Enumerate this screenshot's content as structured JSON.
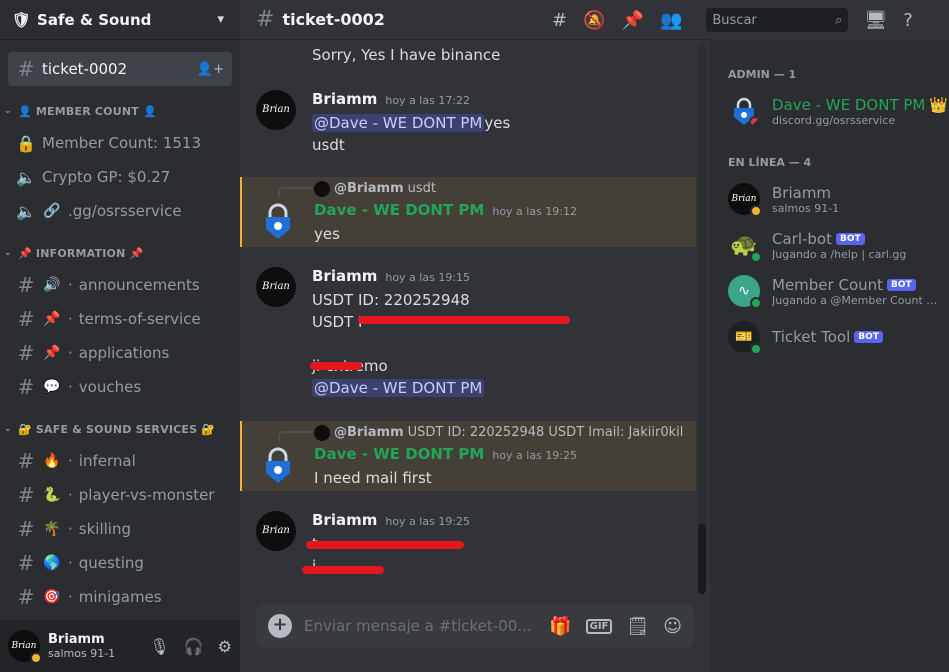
{
  "server": {
    "name": "Safe & Sound"
  },
  "sidebar": {
    "active_channel": "ticket-0002",
    "categories": {
      "member_count": "MEMBER COUNT",
      "information": "INFORMATION",
      "services": "SAFE & SOUND SERVICES"
    },
    "voice": [
      "Member Count: 1513",
      "Crypto GP: $0.27",
      ".gg/osrsservice"
    ],
    "info_channels": [
      "announcements",
      "terms-of-service",
      "applications",
      "vouches"
    ],
    "service_channels": [
      "infernal",
      "player-vs-monster",
      "skilling",
      "questing",
      "minigames"
    ]
  },
  "user": {
    "name": "Briamm",
    "status": "salmos 91-1",
    "avatar_text": "Brian"
  },
  "header": {
    "channel": "ticket-0002",
    "search_placeholder": "Buscar"
  },
  "messages": {
    "m0_text": "Sorry, Yes I have binance",
    "m1": {
      "author": "Briamm",
      "time": "hoy a las 17:22",
      "mention": "@Dave - WE DONT PM",
      "text_a": "yes",
      "text_b": "usdt"
    },
    "m2": {
      "reply_author": "@Briamm",
      "reply_text": "usdt",
      "author": "Dave - WE DONT PM",
      "time": "hoy a las 19:12",
      "text": "yes"
    },
    "m3": {
      "author": "Briamm",
      "time": "hoy a las 19:15",
      "line1": "USDT ID: 220252948",
      "line2": "USDT I",
      "line3": "ji extremo",
      "mention": "@Dave - WE DONT PM"
    },
    "m4": {
      "reply_author": "@Briamm",
      "reply_text": "USDT ID: 220252948 USDT Imail: Jakiir0kil",
      "author": "Dave - WE DONT PM",
      "time": "hoy a las 19:25",
      "text": "I need mail first"
    },
    "m5": {
      "author": "Briamm",
      "time": "hoy a las 19:25",
      "line1": "t",
      "line2": "j"
    }
  },
  "composer": {
    "placeholder": "Enviar mensaje a #ticket-00..."
  },
  "members": {
    "admin_header": "ADMIN — 1",
    "online_header": "EN LÍNEA — 4",
    "admin": {
      "name": "Dave - WE DONT PM",
      "status": "discord.gg/osrsservice"
    },
    "online": [
      {
        "name": "Briamm",
        "status": "salmos 91-1",
        "avatar_text": "Brian"
      },
      {
        "name": "Carl-bot",
        "badge": "BOT",
        "status": "Jugando a /help | carl.gg"
      },
      {
        "name": "Member Count",
        "badge": "BOT",
        "status": "Jugando a @Member Count h..."
      },
      {
        "name": "Ticket Tool",
        "badge": "BOT"
      }
    ]
  },
  "colors": {
    "accent": "#5865f2",
    "admin_name": "#23a559",
    "highlight": "#f0b232",
    "redaction": "#e5171c"
  }
}
